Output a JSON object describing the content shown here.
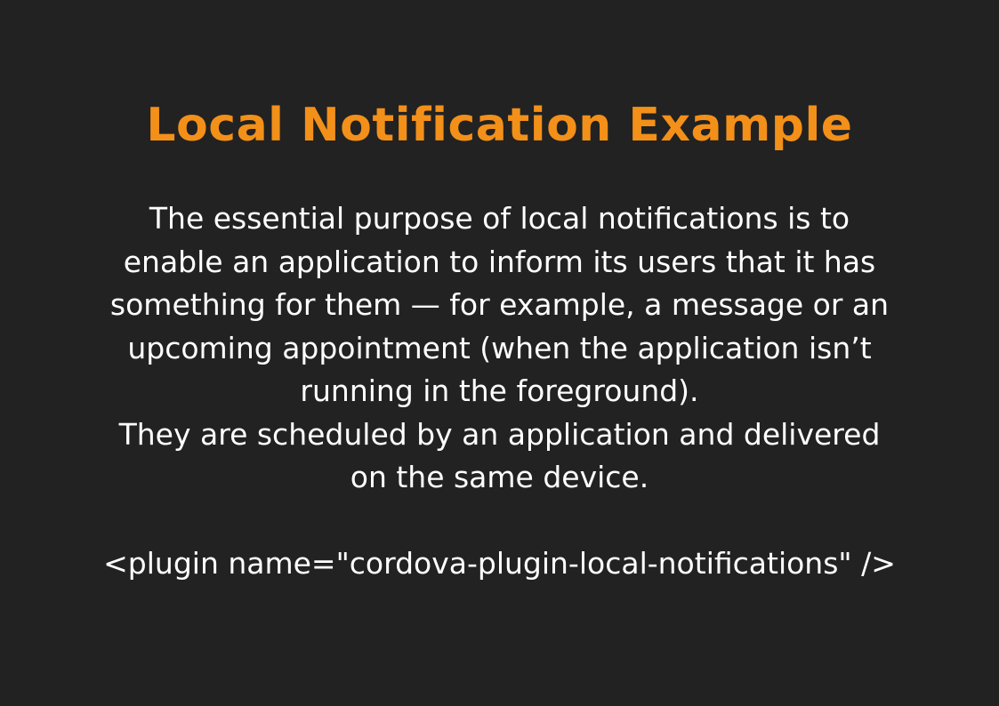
{
  "slide": {
    "title": "Local Notification Example",
    "description_lines": [
      "The essential purpose of local notifications is to",
      "enable an application to inform its users that it has",
      "something for them — for example, a message or an",
      "upcoming appointment (when the application isn’t",
      "running in the foreground).",
      "They are scheduled by an application and delivered",
      "on the same device."
    ],
    "code_line": "<plugin name=\"cordova-plugin-local-notifications\" />"
  },
  "colors": {
    "background": "#222222",
    "title": "#f39019",
    "text": "#ffffff"
  }
}
